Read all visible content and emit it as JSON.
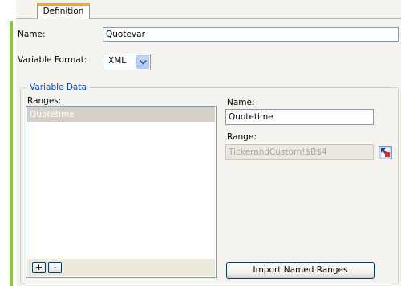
{
  "tabs": [
    {
      "label": "Definition",
      "active": true
    }
  ],
  "form": {
    "name_label": "Name:",
    "name_value": "Quotevar",
    "format_label": "Variable Format:",
    "format_value": "XML"
  },
  "variable_data": {
    "legend": "Variable Data",
    "ranges_label": "Ranges:",
    "ranges": [
      "Quotetime"
    ],
    "add_label": "+",
    "remove_label": "-",
    "detail_name_label": "Name:",
    "detail_name_value": "Quotetime",
    "range_label": "Range:",
    "range_value": "TickerandCustom!$B$4",
    "import_label": "Import Named Ranges"
  },
  "colors": {
    "accent": "#8cc63e",
    "tab_highlight": "#f3a633",
    "legend_text": "#0046d5",
    "selection": "#d4d0c8"
  },
  "icons": {
    "format_dropdown": "chevron-down-icon",
    "range_picker": "range-picker-icon"
  }
}
